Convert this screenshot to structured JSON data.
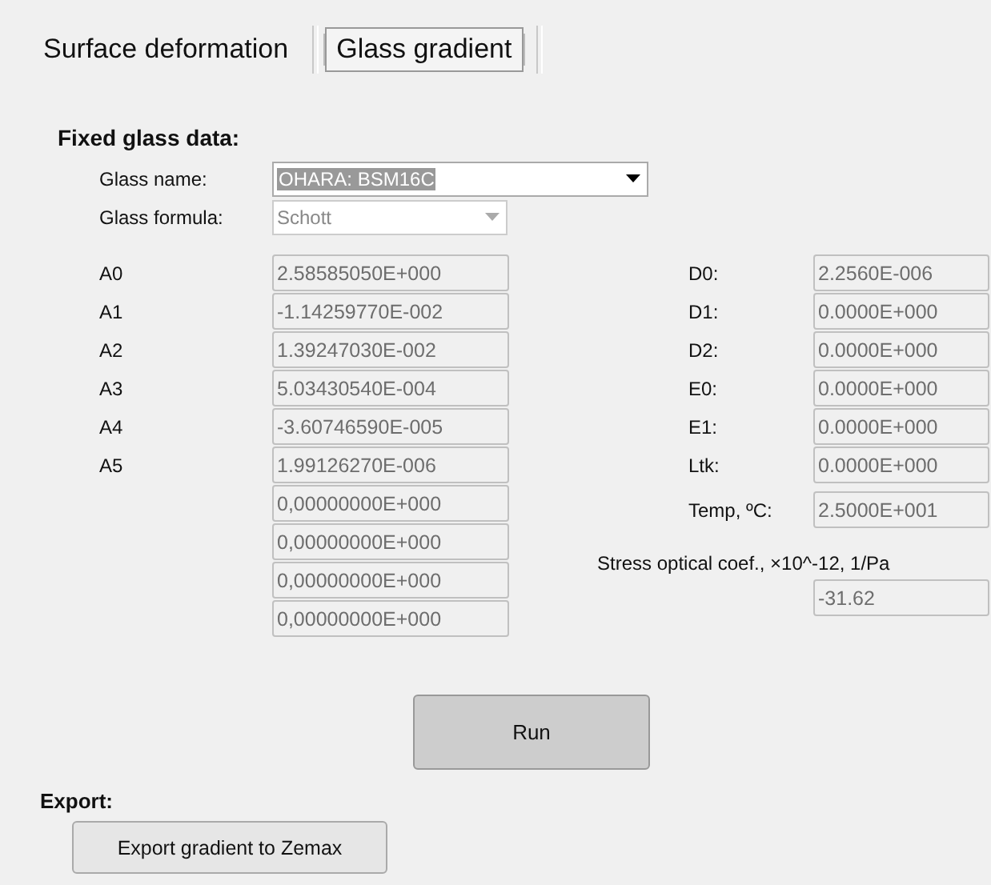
{
  "tabs": [
    {
      "label": "Surface deformation",
      "selected": false
    },
    {
      "label": "Glass gradient",
      "selected": true
    }
  ],
  "fixed_glass": {
    "title": "Fixed glass data:",
    "glass_name": {
      "label": "Glass name:",
      "value": "OHARA:  BSM16C",
      "text_selected": true
    },
    "glass_formula": {
      "label": "Glass formula:",
      "value": "Schott",
      "disabled": true
    }
  },
  "coefficients": [
    {
      "label": "A0",
      "value": "2.58585050E+000"
    },
    {
      "label": "A1",
      "value": "-1.14259770E-002"
    },
    {
      "label": "A2",
      "value": "1.39247030E-002"
    },
    {
      "label": "A3",
      "value": "5.03430540E-004"
    },
    {
      "label": "A4",
      "value": "-3.60746590E-005"
    },
    {
      "label": "A5",
      "value": "1.99126270E-006"
    },
    {
      "value": "0,00000000E+000"
    },
    {
      "value": "0,00000000E+000"
    },
    {
      "value": "0,00000000E+000"
    },
    {
      "value": "0,00000000E+000"
    }
  ],
  "parameters": [
    {
      "label": "D0:",
      "value": "2.2560E-006"
    },
    {
      "label": "D1:",
      "value": "0.0000E+000"
    },
    {
      "label": "D2:",
      "value": "0.0000E+000"
    },
    {
      "label": "E0:",
      "value": "0.0000E+000"
    },
    {
      "label": "E1:",
      "value": "0.0000E+000"
    },
    {
      "label": "Ltk:",
      "value": "0.0000E+000"
    }
  ],
  "temperature": {
    "label": "Temp, ºC:",
    "value": "2.5000E+001"
  },
  "stress": {
    "label": "Stress optical coef., ×10^-12, 1/Pa",
    "value": "-31.62"
  },
  "run_button": "Run",
  "export": {
    "title": "Export:",
    "button": "Export gradient to Zemax"
  }
}
